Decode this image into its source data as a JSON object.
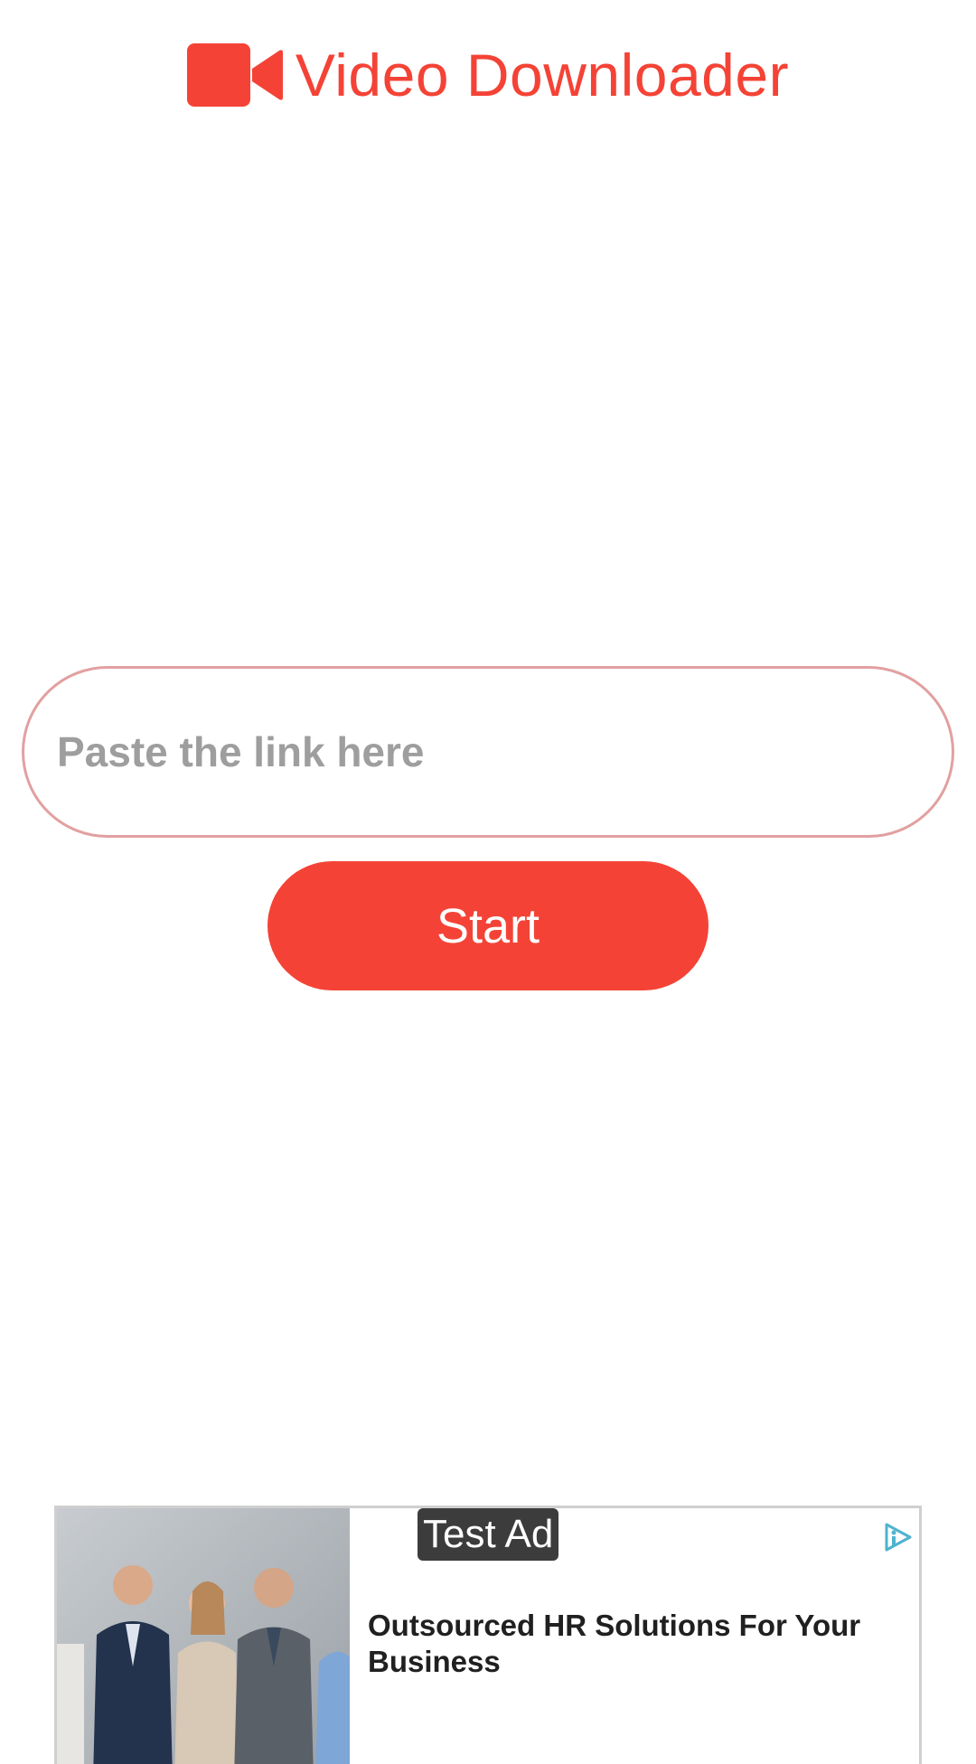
{
  "header": {
    "title": "Video Downloader",
    "logo_icon": "video-camera-icon",
    "accent_color": "#f44336"
  },
  "link_input": {
    "placeholder": "Paste the link here",
    "value": ""
  },
  "start_button": {
    "label": "Start"
  },
  "ad": {
    "label": "Test Ad",
    "headline": "Outsourced HR Solutions For Your Business",
    "choices_icon": "ad-choices-icon"
  }
}
